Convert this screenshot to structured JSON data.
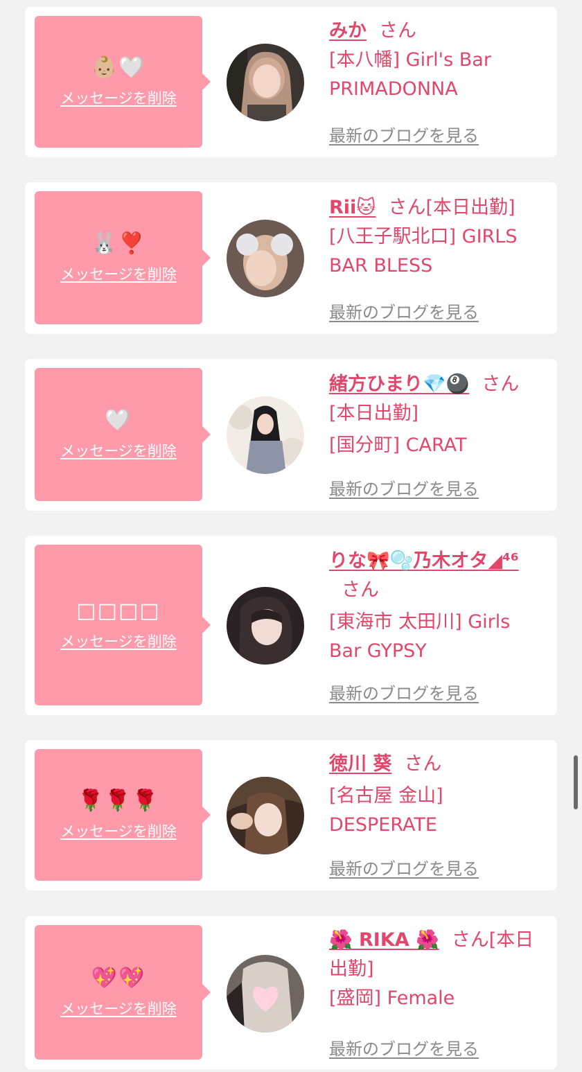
{
  "delete_label": "メッセージを削除",
  "blog_label": "最新のブログを見る",
  "san_label": "さん",
  "colors": {
    "bubble": "#ff9aaa",
    "accent": "#e2476b",
    "link_gray": "#8a8a8a",
    "card_bg": "#ffffff",
    "page_bg": "#f2f2f2"
  },
  "cards": [
    {
      "message": "👶🏼🤍",
      "name": "みか",
      "extra": "",
      "shop": "[本八幡] Girl's Bar PRIMADONNA",
      "avatar_icon": "avatar-photo"
    },
    {
      "message": "🐰❣️",
      "name": "Rii🐱",
      "extra": "[本日出勤]",
      "shop": "[八王子駅北口] GIRLS BAR BLESS",
      "avatar_icon": "avatar-photo"
    },
    {
      "message": "🤍",
      "name": "緒方ひまり💎🎱",
      "extra": "[本日出勤]",
      "shop": "[国分町] CARAT",
      "avatar_icon": "avatar-photo"
    },
    {
      "message": "□□□□",
      "name": "りな🎀🫧乃木オタ◢⁴⁶",
      "extra": "",
      "shop": "[東海市 太田川] Girls Bar GYPSY",
      "avatar_icon": "avatar-photo"
    },
    {
      "message": "🌹🌹🌹",
      "name": "徳川 葵",
      "extra": "",
      "shop": "[名古屋 金山] DESPERATE",
      "avatar_icon": "avatar-photo"
    },
    {
      "message": "💖💖",
      "name": "🌺 RIKA 🌺",
      "extra": "[本日出勤]",
      "shop": "[盛岡] Female",
      "avatar_icon": "avatar-heart-photo"
    }
  ]
}
